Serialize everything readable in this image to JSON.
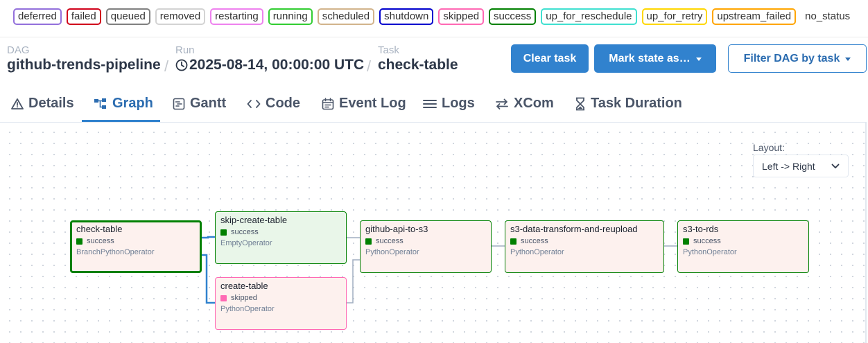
{
  "legend": [
    {
      "label": "deferred",
      "color": "#9370db"
    },
    {
      "label": "failed",
      "color": "#d0021b"
    },
    {
      "label": "queued",
      "color": "#808080"
    },
    {
      "label": "removed",
      "color": "#d3d3d3"
    },
    {
      "label": "restarting",
      "color": "#ee82ee"
    },
    {
      "label": "running",
      "color": "#32cd32"
    },
    {
      "label": "scheduled",
      "color": "#d2b48c"
    },
    {
      "label": "shutdown",
      "color": "#0000cd"
    },
    {
      "label": "skipped",
      "color": "#ff69b4"
    },
    {
      "label": "success",
      "color": "#008000"
    },
    {
      "label": "up_for_reschedule",
      "color": "#40e0d0"
    },
    {
      "label": "up_for_retry",
      "color": "#ffd700"
    },
    {
      "label": "upstream_failed",
      "color": "#ffa500"
    },
    {
      "label": "no_status",
      "color": ""
    }
  ],
  "breadcrumb": {
    "dag_label": "DAG",
    "dag_value": "github-trends-pipeline",
    "run_label": "Run",
    "run_value": "2025-08-14, 00:00:00 UTC",
    "task_label": "Task",
    "task_value": "check-table",
    "separator": "/"
  },
  "actions": {
    "clear": "Clear task",
    "mark": "Mark state as…",
    "filter": "Filter DAG by task"
  },
  "tabs": [
    "Details",
    "Graph",
    "Gantt",
    "Code",
    "Event Log",
    "Logs",
    "XCom",
    "Task Duration"
  ],
  "active_tab": "Graph",
  "graph": {
    "layout_label": "Layout:",
    "layout_value": "Left -> Right",
    "nodes": {
      "check_table": {
        "name": "check-table",
        "state": "success",
        "operator": "BranchPythonOperator"
      },
      "skip_create_table": {
        "name": "skip-create-table",
        "state": "success",
        "operator": "EmptyOperator"
      },
      "create_table": {
        "name": "create-table",
        "state": "skipped",
        "operator": "PythonOperator"
      },
      "github_api_to_s3": {
        "name": "github-api-to-s3",
        "state": "success",
        "operator": "PythonOperator"
      },
      "s3_transform": {
        "name": "s3-data-transform-and-reupload",
        "state": "success",
        "operator": "PythonOperator"
      },
      "s3_to_rds": {
        "name": "s3-to-rds",
        "state": "success",
        "operator": "PythonOperator"
      }
    },
    "colors": {
      "success": "#008000",
      "skipped": "#ff69b4",
      "selected_edge": "#3182ce",
      "edge": "#a0aec0"
    }
  }
}
